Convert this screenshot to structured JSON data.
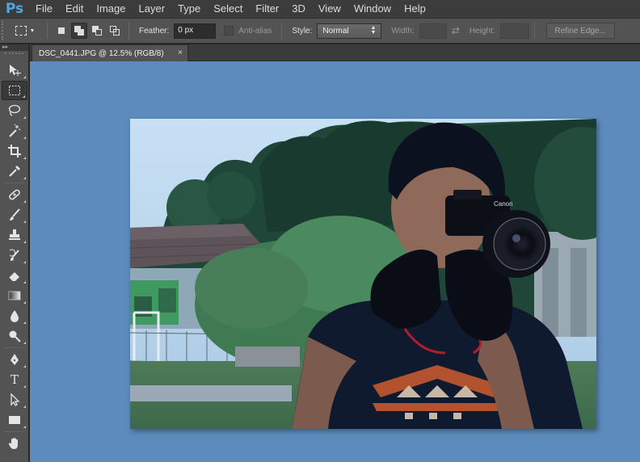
{
  "app": {
    "logo": "Ps"
  },
  "menu": [
    "File",
    "Edit",
    "Image",
    "Layer",
    "Type",
    "Select",
    "Filter",
    "3D",
    "View",
    "Window",
    "Help"
  ],
  "options": {
    "feather_label": "Feather:",
    "feather_value": "0 px",
    "antialias_label": "Anti-alias",
    "style_label": "Style:",
    "style_value": "Normal",
    "width_label": "Width:",
    "height_label": "Height:",
    "refine_label": "Refine Edge..."
  },
  "document": {
    "tab_title": "DSC_0441.JPG @ 12.5% (RGB/8)",
    "close_glyph": "×"
  },
  "tools": [
    "move-tool-icon",
    "rectangular-marquee-tool-icon",
    "lasso-tool-icon",
    "magic-wand-tool-icon",
    "crop-tool-icon",
    "eyedropper-tool-icon",
    "spot-healing-brush-icon",
    "brush-tool-icon",
    "clone-stamp-icon",
    "history-brush-icon",
    "eraser-tool-icon",
    "gradient-tool-icon",
    "blur-tool-icon",
    "dodge-tool-icon",
    "pen-tool-icon",
    "type-tool-icon",
    "path-selection-icon",
    "rectangle-tool-icon",
    "hand-tool-icon"
  ],
  "type_tool_glyph": "T",
  "colors": {
    "canvas_bg": "#5d8bbd",
    "accent": "#4ea7e6"
  },
  "camera_brand": "Canon"
}
